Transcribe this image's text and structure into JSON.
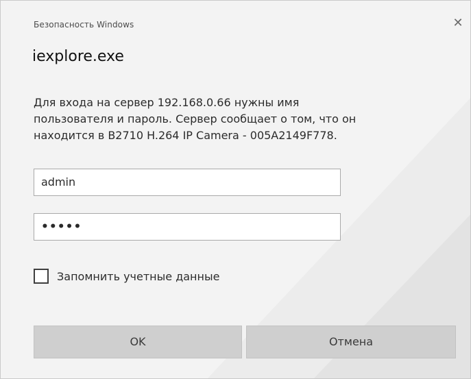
{
  "window": {
    "caption": "Безопасность Windows",
    "close_glyph": "✕"
  },
  "app": {
    "name": "iexplore.exe"
  },
  "message": {
    "line1": "Для входа на сервер 192.168.0.66 нужны имя",
    "line2": "пользователя и пароль. Сервер сообщает о том, что он",
    "line3": "находится в B2710 H.264 IP Camera - 005A2149F778."
  },
  "form": {
    "username_value": "admin",
    "password_masked": "•••••",
    "remember_label": "Запомнить учетные данные",
    "remember_checked": false
  },
  "buttons": {
    "ok_label": "OK",
    "cancel_label": "Отмена"
  },
  "icons": {
    "close": "close-icon"
  },
  "colors": {
    "dialog_bg": "#f3f3f3",
    "button_bg": "#cfcfcf",
    "field_border": "#a9a9a9",
    "watermark": "#e8e8e8"
  }
}
